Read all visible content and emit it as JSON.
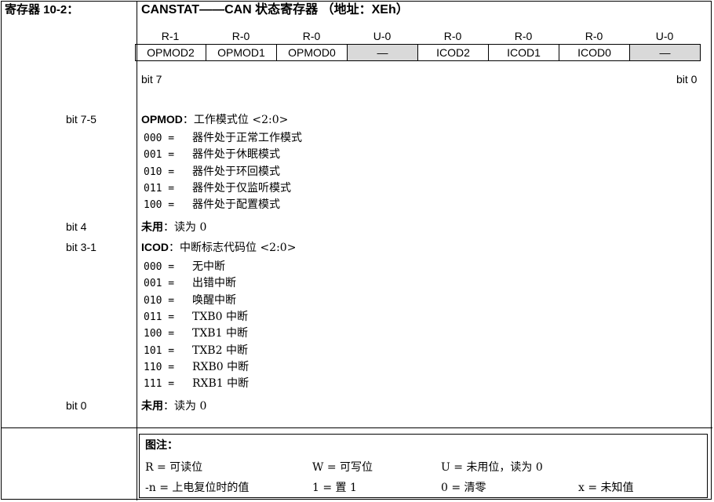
{
  "title_label": "寄存器 10-2：",
  "title_register": "CANSTAT——CAN 状态寄存器 （地址：XEh）",
  "access": [
    "R-1",
    "R-0",
    "R-0",
    "U-0",
    "R-0",
    "R-0",
    "R-0",
    "U-0"
  ],
  "bits": [
    {
      "name": "OPMOD2",
      "unused": false
    },
    {
      "name": "OPMOD1",
      "unused": false
    },
    {
      "name": "OPMOD0",
      "unused": false
    },
    {
      "name": "—",
      "unused": true
    },
    {
      "name": "ICOD2",
      "unused": false
    },
    {
      "name": "ICOD1",
      "unused": false
    },
    {
      "name": "ICOD0",
      "unused": false
    },
    {
      "name": "—",
      "unused": true
    }
  ],
  "bit_high": "bit 7",
  "bit_low": "bit 0",
  "sections": {
    "opmod": {
      "bit": "bit 7-5",
      "name": "OPMOD",
      "desc": "：工作模式位 <2:0>",
      "codes": [
        {
          "code": "000 =",
          "text": "器件处于正常工作模式"
        },
        {
          "code": "001 =",
          "text": "器件处于休眠模式"
        },
        {
          "code": "010 =",
          "text": "器件处于环回模式"
        },
        {
          "code": "011 =",
          "text": "器件处于仅监听模式"
        },
        {
          "code": "100 =",
          "text": "器件处于配置模式"
        }
      ]
    },
    "bit4": {
      "bit": "bit 4",
      "label": "未用",
      "text": "：读为 0"
    },
    "icod": {
      "bit": "bit 3-1",
      "name": "ICOD",
      "desc": "：中断标志代码位 <2:0>",
      "codes": [
        {
          "code": "000 =",
          "text": "无中断"
        },
        {
          "code": "001 =",
          "text": "出错中断"
        },
        {
          "code": "010 =",
          "text": "唤醒中断"
        },
        {
          "code": "011 =",
          "text": "TXB0 中断"
        },
        {
          "code": "100 =",
          "text": "TXB1 中断"
        },
        {
          "code": "101 =",
          "text": "TXB2 中断"
        },
        {
          "code": "110 =",
          "text": "RXB0 中断"
        },
        {
          "code": "111 =",
          "text": "RXB1 中断"
        }
      ]
    },
    "bit0": {
      "bit": "bit 0",
      "label": "未用",
      "text": "：读为 0"
    }
  },
  "legend": {
    "title": "图注：",
    "r": "R = 可读位",
    "w": "W = 可写位",
    "u": "U = 未用位，读为 0",
    "n": "-n = 上电复位时的值",
    "one": "1 = 置 1",
    "zero": "0 = 清零",
    "x": "x = 未知值"
  }
}
